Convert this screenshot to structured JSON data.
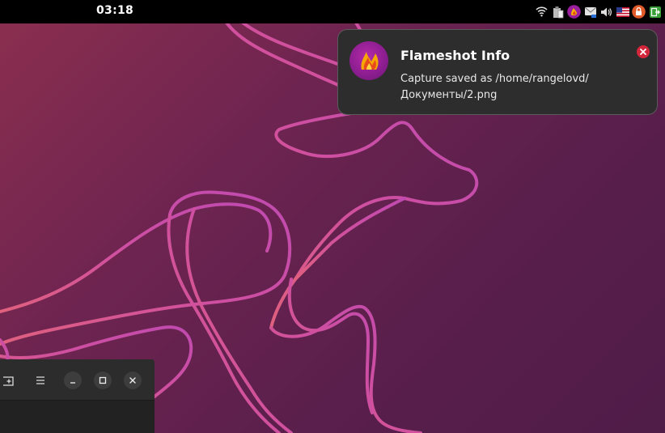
{
  "topbar": {
    "clock": "03:18",
    "tray_icons": [
      "wifi-icon",
      "clipboard-icon",
      "flameshot-icon",
      "mail-icon",
      "volume-icon",
      "keyboard-layout-us-flag-icon",
      "lock-icon",
      "exit-icon"
    ]
  },
  "notification": {
    "title": "Flameshot Info",
    "body_line1": "Capture saved as /home/rangelovd/",
    "body_line2": "Документы/2.png",
    "icon": "flameshot-icon",
    "close_icon": "close-icon"
  },
  "window": {
    "headerbar_buttons": [
      "new-tab-icon",
      "menu-icon",
      "minimize-icon",
      "maximize-icon",
      "close-icon"
    ]
  },
  "colors": {
    "topbar": "#000000",
    "notification_bg": "#2d2d2d",
    "close_button": "#d4263a",
    "wallpaper_line": "#c44aa6"
  }
}
